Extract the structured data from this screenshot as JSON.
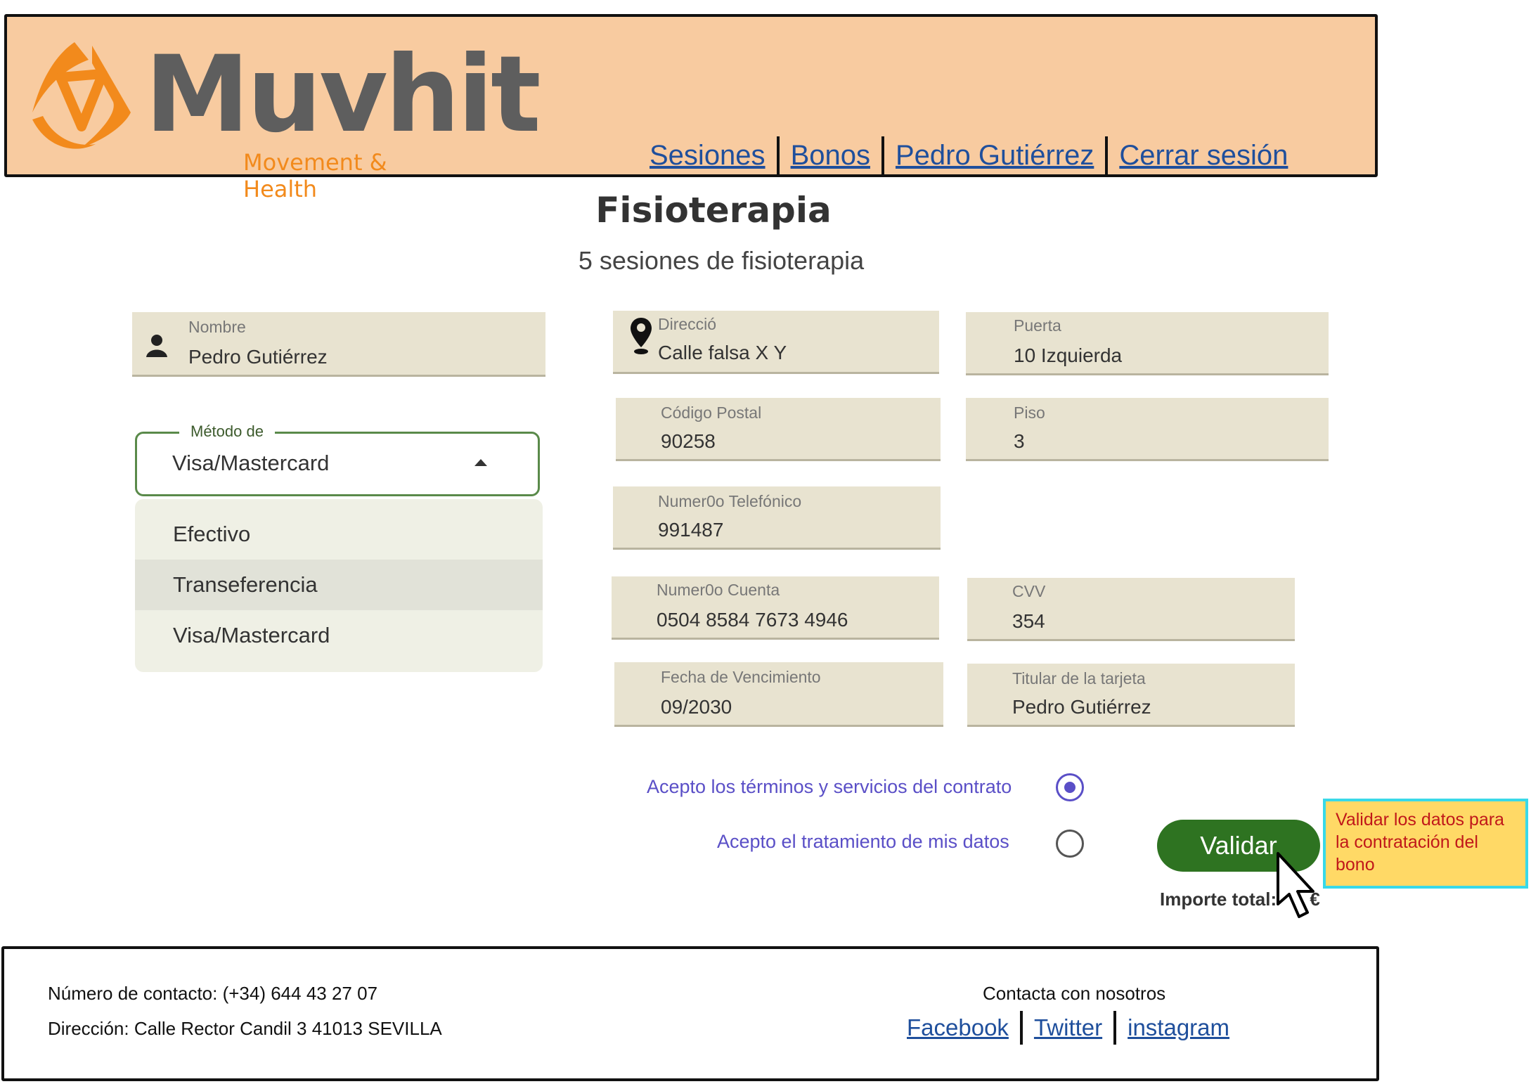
{
  "header": {
    "logo": {
      "word": "Muvhit",
      "tagline": "Movement & Health"
    },
    "nav": [
      "Sesiones",
      "Bonos",
      "Pedro Gutiérrez",
      "Cerrar sesión"
    ]
  },
  "page": {
    "title": "Fisioterapia",
    "subtitle": "5 sesiones de fisioterapia"
  },
  "fields": {
    "nombre": {
      "label": "Nombre",
      "value": "Pedro Gutiérrez",
      "icon": "user-icon"
    },
    "direccion": {
      "label": "Direcció",
      "value": "Calle falsa X Y",
      "icon": "map-pin-icon"
    },
    "puerta": {
      "label": "Puerta",
      "value": "10 Izquierda"
    },
    "codigo_postal": {
      "label": "Código Postal",
      "value": "90258"
    },
    "piso": {
      "label": "Piso",
      "value": "3"
    },
    "telefono": {
      "label": "Numer0o Telefónico",
      "value": "991487"
    },
    "cuenta": {
      "label": "Numer0o Cuenta",
      "value": "0504 8584 7673 4946"
    },
    "cvv": {
      "label": "CVV",
      "value": "354"
    },
    "vencimiento": {
      "label": "Fecha de Vencimiento",
      "value": "09/2030"
    },
    "titular": {
      "label": "Titular de la tarjeta",
      "value": "Pedro Gutiérrez"
    }
  },
  "payment_method": {
    "label": "Método de",
    "selected": "Visa/Mastercard",
    "options": [
      "Efectivo",
      "Transeferencia",
      "Visa/Mastercard"
    ],
    "highlighted_index": 1
  },
  "agreements": {
    "terms": {
      "label": "Acepto los términos y servicios del contrato",
      "checked": true
    },
    "data": {
      "label": "Acepto el tratamiento de mis datos",
      "checked": false
    }
  },
  "validate_button": "Validar",
  "total_label": "Importe total:",
  "total_suffix": "€",
  "tooltip": "Validar los datos para la contratación del bono",
  "footer": {
    "contact_number": "Número de contacto:  (+34) 644 43 27 07",
    "address": "Dirección: Calle Rector Candil 3 41013 SEVILLA",
    "contact_us": "Contacta con nosotros",
    "social": [
      "Facebook",
      "Twitter",
      "instagram"
    ]
  },
  "colors": {
    "header_bg": "#f8cba0",
    "brand_orange": "#f28a1c",
    "button_green": "#2e7321",
    "link_blue": "#1f4f9c",
    "accent_purple": "#5a4fc7",
    "field_bg": "#e8e3d0"
  }
}
